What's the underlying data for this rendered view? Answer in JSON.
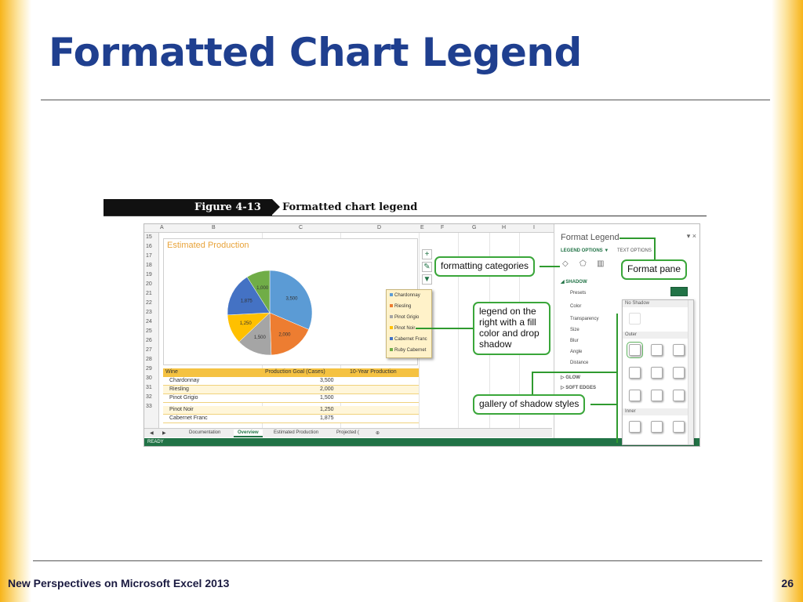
{
  "slide": {
    "title": "Formatted Chart Legend",
    "footer_left": "New Perspectives on Microsoft Excel 2013",
    "page_number": "26"
  },
  "figure": {
    "number": "Figure 4-13",
    "caption": "Formatted chart legend"
  },
  "excel": {
    "column_headers": [
      "A",
      "B",
      "C",
      "D",
      "E",
      "F",
      "G",
      "H",
      "I"
    ],
    "row_numbers": [
      "15",
      "16",
      "17",
      "18",
      "19",
      "20",
      "21",
      "22",
      "23",
      "24",
      "25",
      "26",
      "27",
      "28",
      "29",
      "30",
      "31",
      "32",
      "33"
    ],
    "chart": {
      "title": "Estimated Production",
      "legend": [
        "Chardonnay",
        "Riesling",
        "Pinot Grigio",
        "Pinot Noir",
        "Cabernet Franc",
        "Ruby Cabernet"
      ]
    },
    "chart_tool_icons": [
      "plus-icon",
      "brush-icon",
      "filter-icon"
    ],
    "table": {
      "headers": [
        "Wine",
        "Production Goal (Cases)",
        "10-Year Production"
      ],
      "rows": [
        [
          "Chardonnay",
          "3,500",
          ""
        ],
        [
          "Riesling",
          "2,000",
          ""
        ],
        [
          "Pinot Grigio",
          "1,500",
          ""
        ],
        [
          "Pinot Noir",
          "1,250",
          ""
        ],
        [
          "Cabernet Franc",
          "1,875",
          ""
        ]
      ]
    },
    "sheet_tabs": [
      "Documentation",
      "Overview",
      "Estimated Production",
      "Projected ("
    ],
    "active_sheet": "Overview",
    "status": "READY",
    "pane": {
      "title": "Format Legend",
      "close": "▾ ×",
      "tab_legend_options": "LEGEND OPTIONS ▼",
      "tab_text_options": "TEXT OPTIONS",
      "section_shadow": "◢ SHADOW",
      "fields": [
        "Presets",
        "Color",
        "Transparency",
        "Size",
        "Blur",
        "Angle",
        "Distance"
      ],
      "section_glow": "▷ GLOW",
      "section_soft_edges": "▷ SOFT EDGES",
      "gallery": {
        "no_shadow": "No Shadow",
        "outer": "Outer",
        "inner": "Inner"
      }
    }
  },
  "callouts": {
    "formatting_categories": "formatting categories",
    "format_pane": "Format pane",
    "legend_note": "legend on the right with a fill color and drop shadow",
    "gallery_note": "gallery of shadow styles"
  },
  "chart_data": {
    "type": "pie",
    "title": "Estimated Production",
    "categories": [
      "Chardonnay",
      "Riesling",
      "Pinot Grigio",
      "Pinot Noir",
      "Cabernet Franc",
      "Ruby Cabernet"
    ],
    "values": [
      3500,
      2000,
      1500,
      1250,
      1875,
      1000
    ],
    "labels": [
      "3,500",
      "2,000",
      "1,500",
      "1,250",
      "1,875",
      "1,000"
    ],
    "colors": [
      "#5b9bd5",
      "#ed7d31",
      "#a5a5a5",
      "#ffc000",
      "#4472c4",
      "#70ad47"
    ],
    "legend_position": "right"
  }
}
